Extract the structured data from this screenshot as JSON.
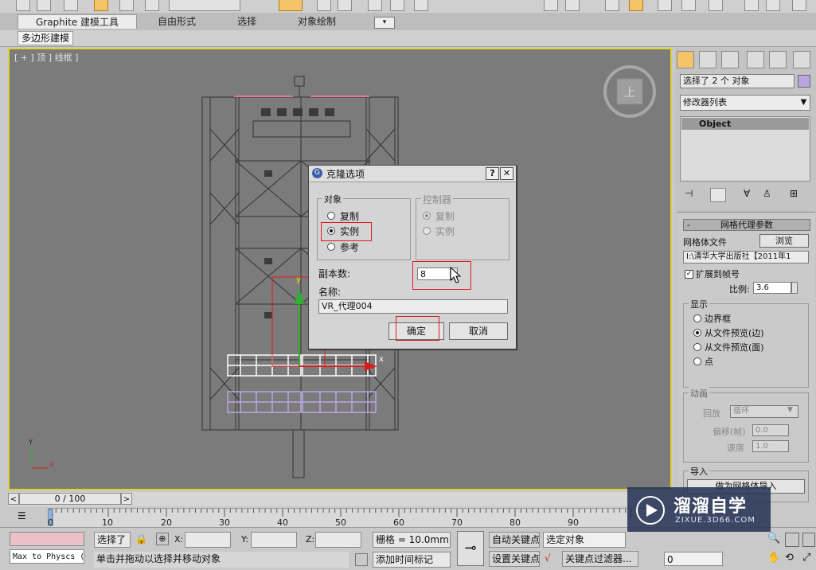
{
  "ribbon": {
    "tabs": [
      "Graphite 建模工具",
      "自由形式",
      "选择",
      "对象绘制"
    ],
    "subtab": "多边形建模"
  },
  "viewport": {
    "label": "[ + ] 顶 ] 线框 ]",
    "viewcube_label": "上",
    "axis_x": "X",
    "axis_y": "Y",
    "gizmo_x": "x",
    "gizmo_y": "y"
  },
  "dialog": {
    "title": "克隆选项",
    "help": "?",
    "close": "✕",
    "object_group": "对象",
    "object_options": [
      "复制",
      "实例",
      "参考"
    ],
    "object_selected": "实例",
    "controller_group": "控制器",
    "controller_options": [
      "复制",
      "实例"
    ],
    "controller_selected": "复制",
    "copies_label": "副本数:",
    "copies_value": "8",
    "name_label": "名称:",
    "name_value": "VR_代理004",
    "ok": "确定",
    "cancel": "取消"
  },
  "panel": {
    "selection": "选择了 2 个 对象",
    "modifier_list": "修改器列表",
    "stack_item": "Object",
    "rollout_title": "网格代理参数",
    "mesh_file_label": "网格体文件",
    "browse": "浏览",
    "mesh_file_value": "I:\\清华大学出版社【2011年1",
    "expand_label": "扩展到帧号",
    "scale_label": "比例:",
    "scale_value": "3.6",
    "display_group": "显示",
    "display_options": [
      "边界框",
      "从文件预览(边)",
      "从文件预览(面)",
      "点"
    ],
    "display_selected": "从文件预览(边)",
    "anim_group": "动画",
    "playback_label": "回放",
    "playback_value": "循环",
    "offset_label": "偏移(帧)",
    "offset_value": "0.0",
    "speed_label": "速度",
    "speed_value": "1.0",
    "import_group": "导入",
    "import_button": "做为网格体导入"
  },
  "timeline": {
    "frame_display": "0 / 100",
    "ticks": [
      "0",
      "10",
      "20",
      "30",
      "40",
      "50",
      "60",
      "70",
      "80",
      "90"
    ]
  },
  "status": {
    "max_script": "Max to Physcs (",
    "selection_summary": "选择了",
    "x_label": "X:",
    "y_label": "Y:",
    "z_label": "Z:",
    "grid": "栅格 = 10.0mm",
    "auto_key": "自动关键点",
    "set_key": "设置关键点",
    "selected_object": "选定对象",
    "key_filters": "关键点过滤器...",
    "prompt": "单击并拖动以选择并移动对象",
    "add_time_tag": "添加时间标记",
    "frame_field": "0"
  },
  "watermark": {
    "title": "溜溜自学",
    "url": "ZIXUE.3D66.COM"
  },
  "colors": {
    "viewport_bg": "#7b7b7b",
    "viewport_border": "#e0d23a",
    "highlight_red": "#e0191d",
    "selection_white": "#ffffff",
    "proxy_lilac": "#b9a6e0"
  }
}
